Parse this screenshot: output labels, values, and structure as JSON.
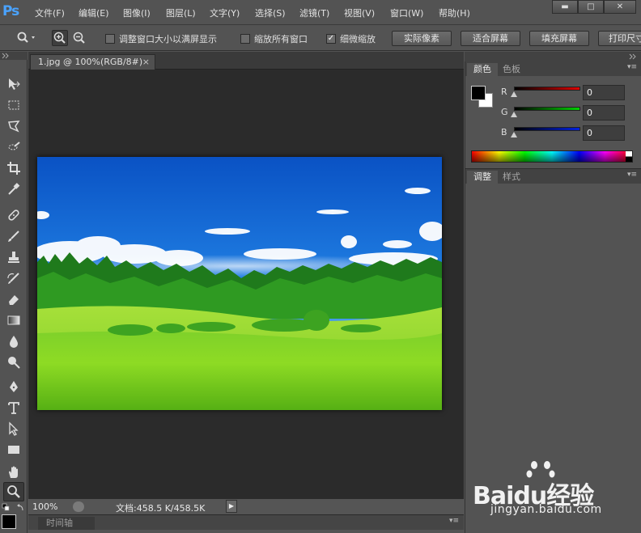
{
  "app": {
    "logo": "Ps"
  },
  "menu": [
    {
      "id": "file",
      "label": "文件(F)"
    },
    {
      "id": "edit",
      "label": "编辑(E)"
    },
    {
      "id": "image",
      "label": "图像(I)"
    },
    {
      "id": "layer",
      "label": "图层(L)"
    },
    {
      "id": "type",
      "label": "文字(Y)"
    },
    {
      "id": "select",
      "label": "选择(S)"
    },
    {
      "id": "filter",
      "label": "滤镜(T)"
    },
    {
      "id": "view",
      "label": "视图(V)"
    },
    {
      "id": "window",
      "label": "窗口(W)"
    },
    {
      "id": "help",
      "label": "帮助(H)"
    }
  ],
  "window_controls": {
    "minimize": "▬",
    "maximize": "□",
    "close": "✕"
  },
  "options": {
    "resize_windows_label": "调整窗口大小以满屏显示",
    "resize_windows_checked": false,
    "zoom_all_label": "缩放所有窗口",
    "zoom_all_checked": false,
    "scrubby_zoom_label": "细微缩放",
    "scrubby_zoom_checked": true,
    "check_mark": "✓",
    "actual_pixels": "实际像素",
    "fit_screen": "适合屏幕",
    "fill_screen": "填充屏幕",
    "print_size": "打印尺寸"
  },
  "tools": [
    "move-tool-icon",
    "marquee-tool-icon",
    "lasso-tool-icon",
    "quick-select-tool-icon",
    "crop-tool-icon",
    "eyedropper-tool-icon",
    "healing-brush-tool-icon",
    "brush-tool-icon",
    "clone-stamp-tool-icon",
    "history-brush-tool-icon",
    "eraser-tool-icon",
    "gradient-tool-icon",
    "blur-tool-icon",
    "dodge-tool-icon",
    "pen-tool-icon",
    "type-tool-icon",
    "path-select-tool-icon",
    "rectangle-tool-icon",
    "hand-tool-icon",
    "zoom-tool-icon"
  ],
  "document": {
    "tab_title": "1.jpg @ 100%(RGB/8#)",
    "close_glyph": "×",
    "zoom": "100%",
    "doc_size": "文档:458.5 K/458.5K",
    "arrow": "▶"
  },
  "timeline": {
    "tab": "时间轴"
  },
  "color_panel": {
    "tabs": [
      "颜色",
      "色板"
    ],
    "active_tab": 0,
    "channels": [
      {
        "label": "R",
        "value": "0",
        "color": "#d00000"
      },
      {
        "label": "G",
        "value": "0",
        "color": "#00c000"
      },
      {
        "label": "B",
        "value": "0",
        "color": "#0018d0"
      }
    ]
  },
  "adjust_panel": {
    "tabs": [
      "调整",
      "样式"
    ],
    "active_tab": 0
  },
  "panel_menu_glyph": "▾≡",
  "watermark": {
    "logo": "Baidu经验",
    "url": "jingyan.baidu.com"
  }
}
